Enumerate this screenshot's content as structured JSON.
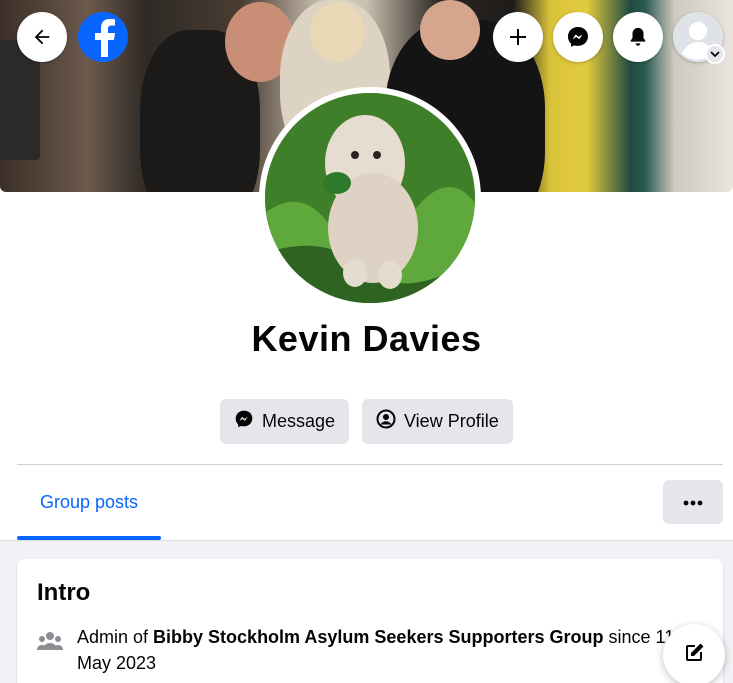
{
  "header": {
    "back_icon": "arrow-left-icon",
    "logo_icon": "facebook-logo-icon",
    "create_icon": "plus-icon",
    "messenger_icon": "messenger-icon",
    "notifications_icon": "bell-icon",
    "account_icon": "avatar-icon"
  },
  "profile": {
    "name": "Kevin Davies",
    "message_label": "Message",
    "view_profile_label": "View Profile"
  },
  "tabs": [
    {
      "label": "Group posts",
      "active": true
    }
  ],
  "intro": {
    "title": "Intro",
    "prefix": "Admin of ",
    "group_name": "Bibby Stockholm Asylum Seekers Supporters Group",
    "suffix": " since 11 May 2023"
  },
  "colors": {
    "accent": "#0866ff",
    "button_bg": "#e4e6eb",
    "feed_bg": "#f0f2f5"
  }
}
